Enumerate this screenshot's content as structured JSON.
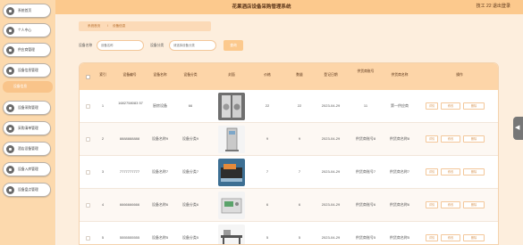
{
  "header": {
    "title": "花果酒店设备采购管理系统",
    "user": "技工 22  退出登录"
  },
  "sidebar": {
    "items": [
      {
        "label": "系统首页"
      },
      {
        "label": "个人中心"
      },
      {
        "label": "供应商管理"
      },
      {
        "label": "设备信息管理"
      },
      {
        "label": "设备采购管理"
      },
      {
        "label": "采购清单管理"
      },
      {
        "label": "酒店设备管理"
      },
      {
        "label": "设备入库管理"
      },
      {
        "label": "设备盘点管理"
      }
    ],
    "active_sub": "设备信息"
  },
  "breadcrumb": {
    "home": "系统首页",
    "sep": "/",
    "current": "设备信息"
  },
  "search": {
    "name_label": "设备名称",
    "name_placeholder": "设备名称",
    "cat_label": "设备分类",
    "cat_placeholder": "请选择设备分类",
    "button": "查询"
  },
  "table": {
    "headers": [
      "索引",
      "设备编号",
      "设备名称",
      "设备分类",
      "封面",
      "价格",
      "数量",
      "登记日期",
      "供货商账号",
      "供货商名称",
      "操作"
    ],
    "actions": [
      "详情",
      "修改",
      "删除"
    ],
    "rows": [
      {
        "index": "1",
        "code": "1682758083 57",
        "name": "厨房设备",
        "category": "66",
        "price": "22",
        "qty": "22",
        "date": "2023-04-29",
        "supplier_id": "11",
        "supplier_name": "第一供应商"
      },
      {
        "index": "2",
        "code": "8888888888",
        "name": "设备名称9",
        "category": "设备分类9",
        "price": "9",
        "qty": "9",
        "date": "2023-04-29",
        "supplier_id": "供货商账号8",
        "supplier_name": "供货商名称8"
      },
      {
        "index": "3",
        "code": "7777777777",
        "name": "设备名称7",
        "category": "设备分类7",
        "price": "7",
        "qty": "7",
        "date": "2023-04-29",
        "supplier_id": "供货商账号7",
        "supplier_name": "供货商名称7"
      },
      {
        "index": "4",
        "code": "6666666666",
        "name": "设备名称6",
        "category": "设备分类6",
        "price": "6",
        "qty": "6",
        "date": "2023-04-29",
        "supplier_id": "供货商账号6",
        "supplier_name": "供货商名称6"
      },
      {
        "index": "5",
        "code": "5555555555",
        "name": "设备名称5",
        "category": "设备分类5",
        "price": "5",
        "qty": "5",
        "date": "2023-04-29",
        "supplier_id": "供货商账号5",
        "supplier_name": "供货商名称5"
      }
    ]
  },
  "side_tab": {
    "icon": "arrow-left-icon",
    "glyph": "◀"
  },
  "colors": {
    "header": "#fcc98d",
    "sidebar": "#fcd9ad",
    "accent": "#f9c48a"
  }
}
